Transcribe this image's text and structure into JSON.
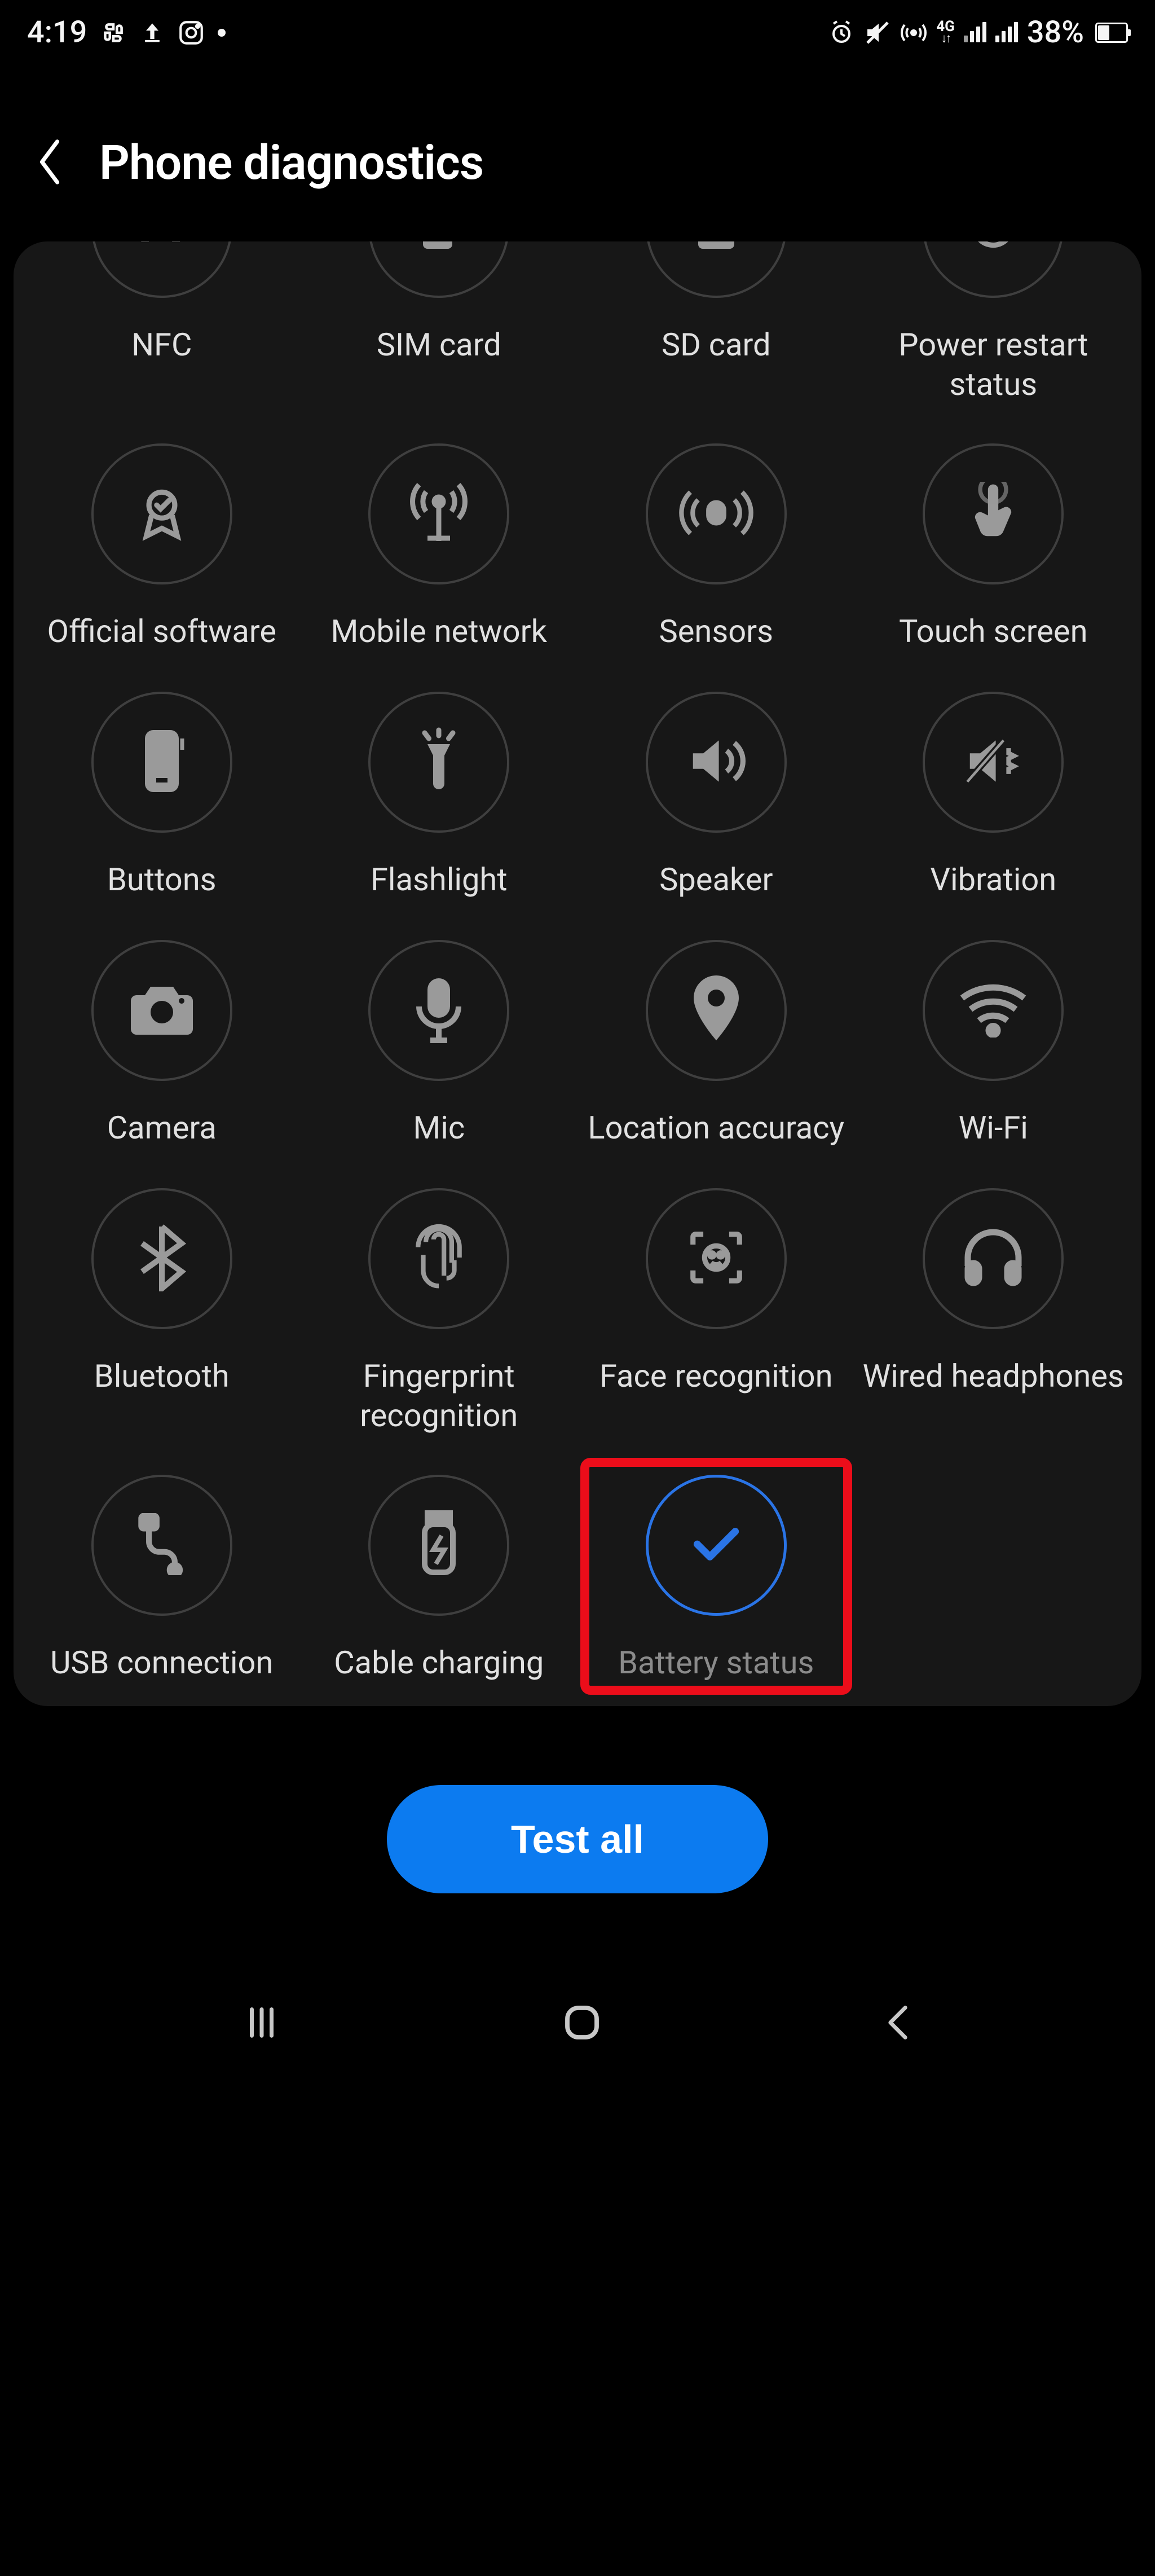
{
  "status_bar": {
    "time": "4:19",
    "battery_pct": "38%"
  },
  "header": {
    "title": "Phone diagnostics"
  },
  "tiles": {
    "nfc": "NFC",
    "sim": "SIM card",
    "sd": "SD card",
    "power_restart": "Power restart status",
    "official_sw": "Official software",
    "mobile_net": "Mobile network",
    "sensors": "Sensors",
    "touch": "Touch screen",
    "buttons": "Buttons",
    "flashlight": "Flashlight",
    "speaker": "Speaker",
    "vibration": "Vibration",
    "camera": "Camera",
    "mic": "Mic",
    "location": "Location accuracy",
    "wifi": "Wi-Fi",
    "bluetooth": "Bluetooth",
    "fingerprint": "Fingerprint recognition",
    "face": "Face recognition",
    "headphones": "Wired headphones",
    "usb": "USB connection",
    "cable_charge": "Cable charging",
    "battery_status": "Battery status"
  },
  "cta": {
    "label": "Test all"
  }
}
